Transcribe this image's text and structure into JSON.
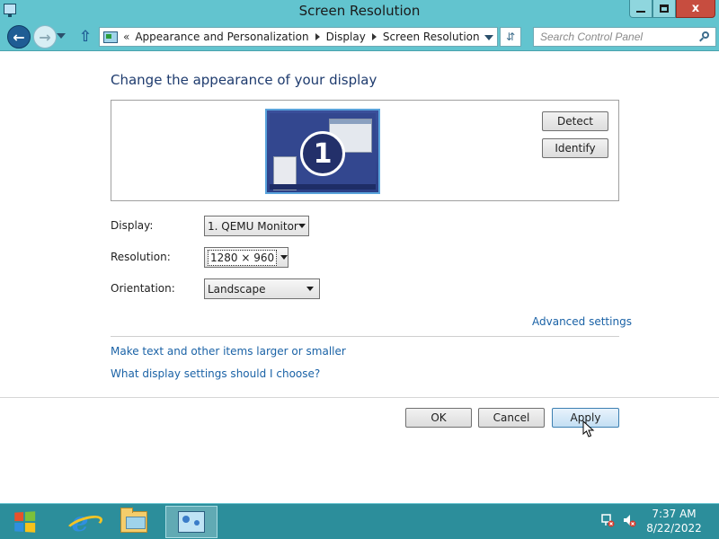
{
  "window": {
    "title": "Screen Resolution",
    "min_label": "",
    "max_label": "",
    "close_label": "x"
  },
  "address": {
    "overflow": "«",
    "crumbs": [
      "Appearance and Personalization",
      "Display",
      "Screen Resolution"
    ]
  },
  "search": {
    "placeholder": "Search Control Panel"
  },
  "main": {
    "heading": "Change the appearance of your display",
    "monitor_number": "1",
    "detect_label": "Detect",
    "identify_label": "Identify",
    "display_label": "Display:",
    "display_value": "1. QEMU Monitor",
    "resolution_label": "Resolution:",
    "resolution_value": "1280 × 960",
    "orientation_label": "Orientation:",
    "orientation_value": "Landscape",
    "advanced_link": "Advanced settings",
    "link_larger": "Make text and other items larger or smaller",
    "link_help": "What display settings should I choose?",
    "ok_label": "OK",
    "cancel_label": "Cancel",
    "apply_label": "Apply"
  },
  "taskbar": {
    "items": [
      "start-icon",
      "internet-explorer-icon",
      "file-explorer-icon",
      "control-panel-icon"
    ],
    "time": "7:37 AM",
    "date": "8/22/2022"
  },
  "colors": {
    "chrome": "#62c4cf",
    "taskbar": "#2c8e9b",
    "heading": "#1e3b6e",
    "link": "#1a62a6",
    "close_button": "#c74d3f"
  }
}
